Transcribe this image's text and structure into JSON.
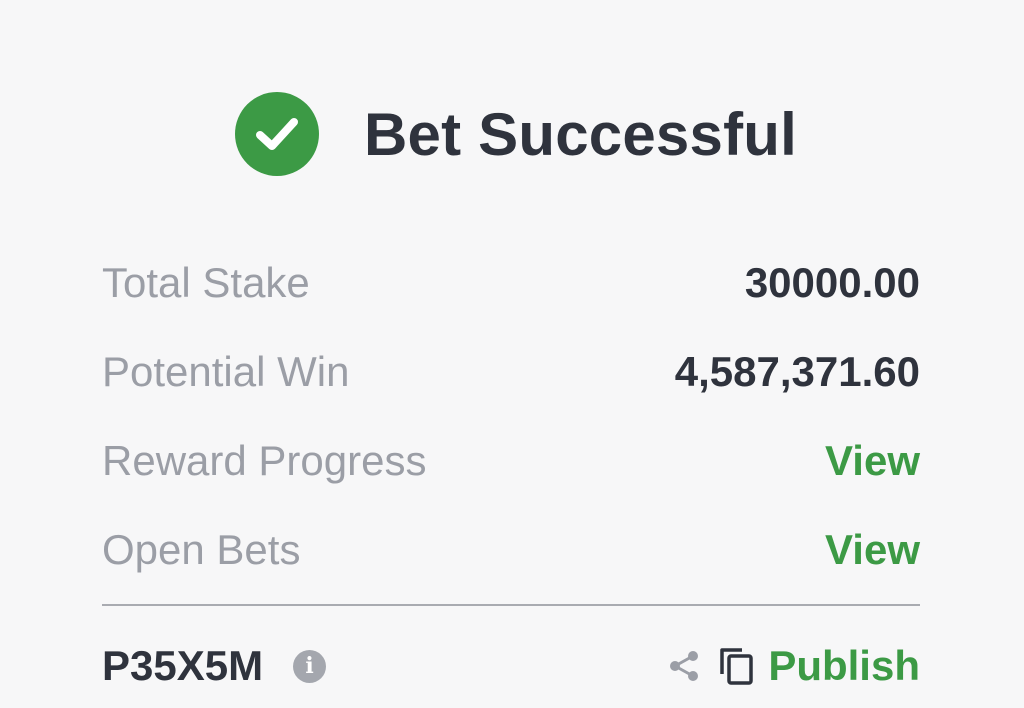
{
  "header": {
    "title": "Bet Successful",
    "icon": "check-circle-icon"
  },
  "summary": [
    {
      "label": "Total Stake",
      "value": "30000.00",
      "type": "value"
    },
    {
      "label": "Potential Win",
      "value": "4,587,371.60",
      "type": "value"
    },
    {
      "label": "Reward Progress",
      "value": "View",
      "type": "link"
    },
    {
      "label": "Open Bets",
      "value": "View",
      "type": "link"
    }
  ],
  "footer": {
    "booking_code": "P35X5M",
    "info_icon": "info-icon",
    "share_icon": "share-icon",
    "copy_icon": "copy-icon",
    "publish_label": "Publish"
  },
  "colors": {
    "accent": "#3c9a45",
    "text_dark": "#2f333d",
    "text_muted": "#9b9ea6",
    "background": "#f7f7f8"
  }
}
